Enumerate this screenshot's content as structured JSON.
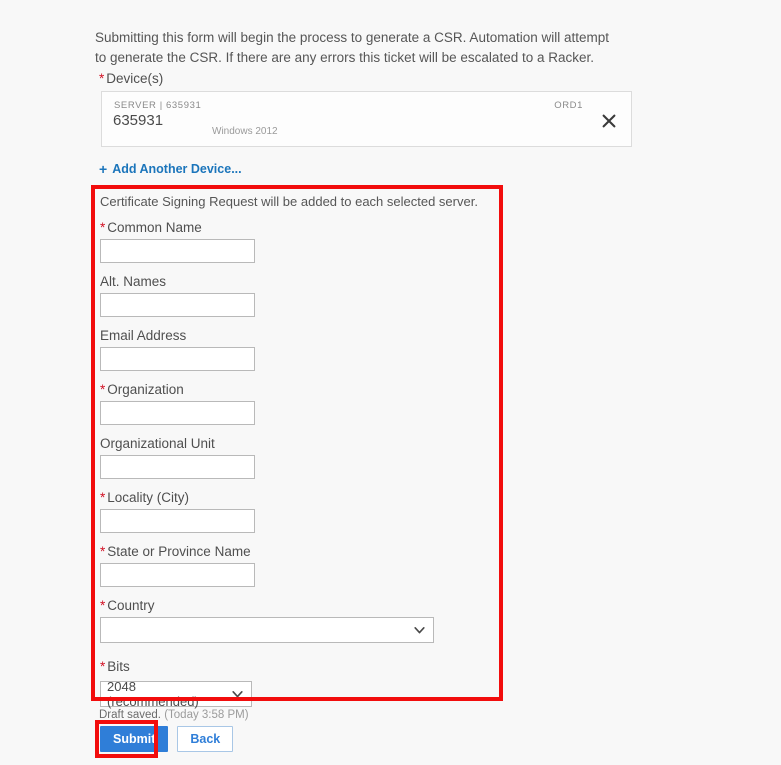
{
  "intro": {
    "paragraph": "Submitting this form will begin the process to generate a CSR. Automation will attempt to generate the CSR. If there are any errors this ticket will be escalated to a Racker."
  },
  "devices_section": {
    "label": "Device(s)",
    "required_marker": "*",
    "card": {
      "type_line": "SERVER | 635931",
      "id": "635931",
      "os": "Windows 2012",
      "region": "ORD1",
      "remove_icon": "close-icon"
    },
    "add_device_link": {
      "icon": "plus-icon",
      "label": "Add Another Device..."
    }
  },
  "csr_form": {
    "note": "Certificate Signing Request will be added to each selected server.",
    "fields": [
      {
        "label": "Common Name",
        "required": true,
        "type": "text",
        "value": ""
      },
      {
        "label": "Alt. Names",
        "required": false,
        "type": "text",
        "value": ""
      },
      {
        "label": "Email Address",
        "required": false,
        "type": "text",
        "value": ""
      },
      {
        "label": "Organization",
        "required": true,
        "type": "text",
        "value": ""
      },
      {
        "label": "Organizational Unit",
        "required": false,
        "type": "text",
        "value": ""
      },
      {
        "label": "Locality (City)",
        "required": true,
        "type": "text",
        "value": ""
      },
      {
        "label": "State or Province Name",
        "required": true,
        "type": "text",
        "value": ""
      },
      {
        "label": "Country",
        "required": true,
        "type": "select",
        "value": ""
      },
      {
        "label": "Bits",
        "required": true,
        "type": "select",
        "value": "2048 (recommended)"
      }
    ]
  },
  "footer": {
    "draft_status": "Draft saved.",
    "draft_time": "(Today 3:58 PM)",
    "submit_label": "Submit",
    "back_label": "Back"
  },
  "annotations": {
    "highlight_color": "#f20d0d",
    "boxes": [
      "csr-form-section",
      "submit-button"
    ]
  },
  "colors": {
    "required_star": "#d11124",
    "link": "#1b75bb",
    "primary_button": "#2f7ed8",
    "page_background": "#f8f8f8"
  }
}
